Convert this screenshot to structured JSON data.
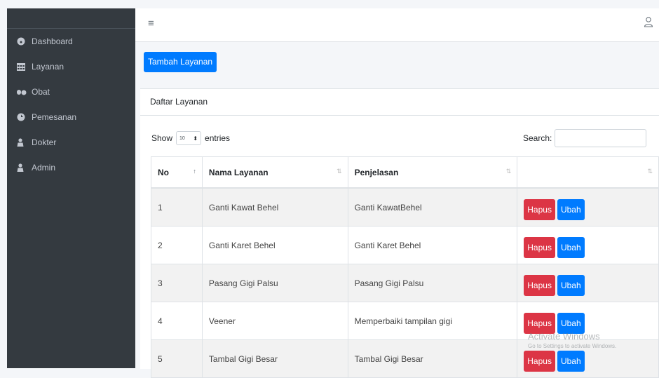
{
  "colors": {
    "sidebar_bg": "#343a40",
    "primary": "#007bff",
    "danger": "#dc3545"
  },
  "sidebar": {
    "items": [
      {
        "label": "Dashboard",
        "icon": "dashboard-icon"
      },
      {
        "label": "Layanan",
        "icon": "table-icon"
      },
      {
        "label": "Obat",
        "icon": "pills-icon"
      },
      {
        "label": "Pemesanan",
        "icon": "cart-icon"
      },
      {
        "label": "Dokter",
        "icon": "person-icon"
      },
      {
        "label": "Admin",
        "icon": "person-icon"
      }
    ]
  },
  "topbar": {
    "menu_icon": "≡"
  },
  "actions": {
    "add_label": "Tambah Layanan"
  },
  "card": {
    "title": "Daftar Layanan",
    "show_label": "Show",
    "entries_value": "10",
    "entries_label": "entries",
    "search_label": "Search:"
  },
  "table": {
    "headers": [
      "No",
      "Nama Layanan",
      "Penjelasan",
      ""
    ],
    "rows": [
      {
        "no": "1",
        "nama": "Ganti Kawat Behel",
        "penjelasan": "Ganti KawatBehel"
      },
      {
        "no": "2",
        "nama": "Ganti Karet Behel",
        "penjelasan": "Ganti Karet Behel"
      },
      {
        "no": "3",
        "nama": "Pasang Gigi Palsu",
        "penjelasan": "Pasang Gigi Palsu"
      },
      {
        "no": "4",
        "nama": "Veener",
        "penjelasan": "Memperbaiki tampilan gigi"
      },
      {
        "no": "5",
        "nama": "Tambal Gigi Besar",
        "penjelasan": "Tambal Gigi Besar"
      }
    ],
    "delete_label": "Hapus",
    "edit_label": "Ubah"
  },
  "watermark": {
    "line1": "Activate Windows",
    "line2": "Go to Settings to activate Windows."
  }
}
